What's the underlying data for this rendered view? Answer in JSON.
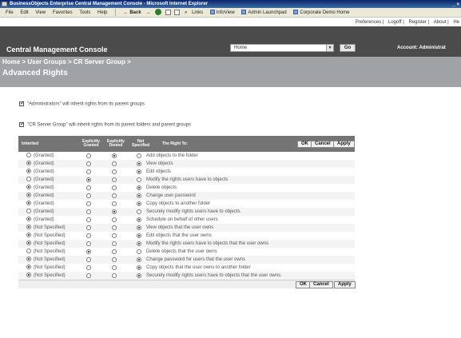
{
  "window": {
    "title": "BusinessObjects Enterprise Central Management Console - Microsoft Internet Explorer",
    "controls": "_ ×"
  },
  "menu": [
    "File",
    "Edit",
    "View",
    "Favorites",
    "Tools",
    "Help"
  ],
  "toolbar": {
    "back": "Back",
    "forward": "→",
    "more": "»",
    "links_label": "Links",
    "links": [
      "InfoView",
      "Admin Launchpad",
      "Corporate Demo Home"
    ]
  },
  "header": {
    "utility_links": [
      "Preferences",
      "Logoff",
      "Register",
      "About",
      "He"
    ],
    "console_title": "Central Management Console",
    "home_select": "Home",
    "go_label": "Go",
    "account_label": "Account: Administrat"
  },
  "breadcrumb": "Home > User Groups > CR Server Group >",
  "page_title": "Advanced Rights",
  "checkboxes": [
    "\"Administrators\" will inherit rights from its parent groups",
    "\"CR Server Group\" will inherit rights from its parent folders and parent groups"
  ],
  "table": {
    "headers": {
      "inherited": "Inherited",
      "explicitly_granted": [
        "Explicitly",
        "Granted"
      ],
      "explicitly_denied": [
        "Explicitly",
        "Denied"
      ],
      "not_specified": [
        "Not",
        "Specified"
      ],
      "right_to": "The Right To:"
    },
    "buttons": {
      "ok": "OK",
      "cancel": "Cancel",
      "apply": "Apply"
    },
    "rows": [
      {
        "inherited": "(Granted)",
        "inh_on": false,
        "state": "denied",
        "right": "Add objects to the folder"
      },
      {
        "inherited": "(Granted)",
        "inh_on": true,
        "state": "not",
        "right": "View objects"
      },
      {
        "inherited": "(Granted)",
        "inh_on": true,
        "state": "not",
        "right": "Edit objects"
      },
      {
        "inherited": "(Granted)",
        "inh_on": false,
        "state": "granted",
        "right": "Modify the rights users have to objects"
      },
      {
        "inherited": "(Granted)",
        "inh_on": true,
        "state": "not",
        "right": "Delete objects"
      },
      {
        "inherited": "(Granted)",
        "inh_on": true,
        "state": "not",
        "right": "Change user password"
      },
      {
        "inherited": "(Granted)",
        "inh_on": true,
        "state": "not",
        "right": "Copy objects to another folder"
      },
      {
        "inherited": "(Granted)",
        "inh_on": false,
        "state": "denied",
        "right": "Securely modify rights users have to objects."
      },
      {
        "inherited": "(Granted)",
        "inh_on": true,
        "state": "not",
        "right": "Schedule on behalf of other users"
      },
      {
        "inherited": "(Not Specified)",
        "inh_on": true,
        "state": "not",
        "right": "View objects that the user owns"
      },
      {
        "inherited": "(Not Specified)",
        "inh_on": true,
        "state": "not",
        "right": "Edit objects that the user owns"
      },
      {
        "inherited": "(Not Specified)",
        "inh_on": true,
        "state": "not",
        "right": "Modify the rights users have to objects that the user owns"
      },
      {
        "inherited": "(Not Specified)",
        "inh_on": false,
        "state": "granted",
        "right": "Delete objects that the user owns"
      },
      {
        "inherited": "(Not Specified)",
        "inh_on": true,
        "state": "not",
        "right": "Change password for users that the user owns"
      },
      {
        "inherited": "(Not Specified)",
        "inh_on": true,
        "state": "not",
        "right": "Copy objects that the user owns to another folder"
      },
      {
        "inherited": "(Not Specified)",
        "inh_on": true,
        "state": "not",
        "right": "Securely modify rights users have to objects that the user owns."
      }
    ]
  }
}
